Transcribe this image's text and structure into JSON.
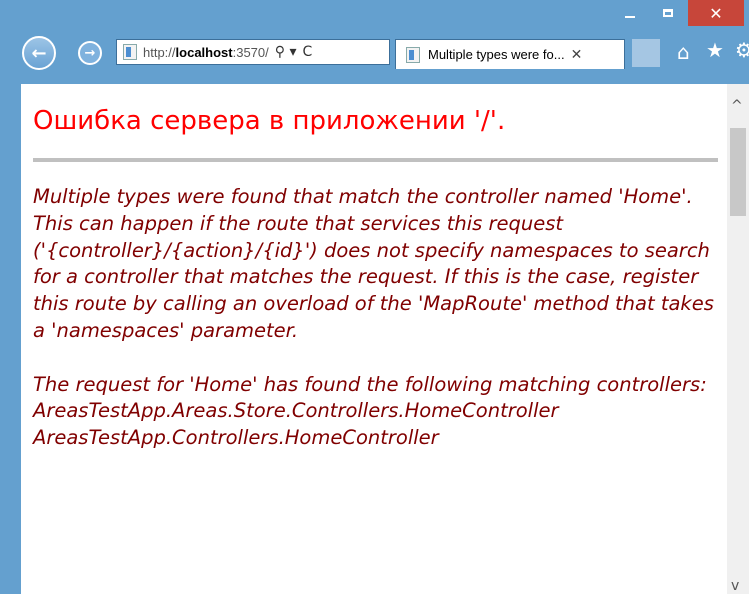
{
  "window": {
    "minimize_symbol": "",
    "close_symbol": "✕"
  },
  "nav": {
    "back_symbol": "←",
    "forward_symbol": "→"
  },
  "address": {
    "url_prefix": "http://",
    "url_host": "localhost",
    "url_suffix": ":3570/",
    "search_symbol": "⚲ ▾",
    "refresh_symbol": "C"
  },
  "tab": {
    "title": "Multiple types were fo...",
    "close_symbol": "✕"
  },
  "toolbar": {
    "home_symbol": "⌂",
    "favorites_symbol": "★",
    "settings_symbol": "⚙"
  },
  "page": {
    "title": "Ошибка сервера в приложении '/'.",
    "message": "Multiple types were found that match the controller named 'Home'. This can happen if the route that services this request ('{controller}/{action}/{id}') does not specify namespaces to search for a controller that matches the request. If this is the case, register this route by calling an overload of the 'MapRoute' method that takes a 'namespaces' parameter.\n\nThe request for 'Home' has found the following matching controllers:\nAreasTestApp.Areas.Store.Controllers.HomeController\nAreasTestApp.Controllers.HomeController"
  },
  "scrollbar": {
    "up_symbol": "^",
    "down_symbol": "v"
  },
  "colors": {
    "title": "#ff0000",
    "message": "#800000",
    "frame": "#64a0cf",
    "close_button": "#c7463a"
  }
}
